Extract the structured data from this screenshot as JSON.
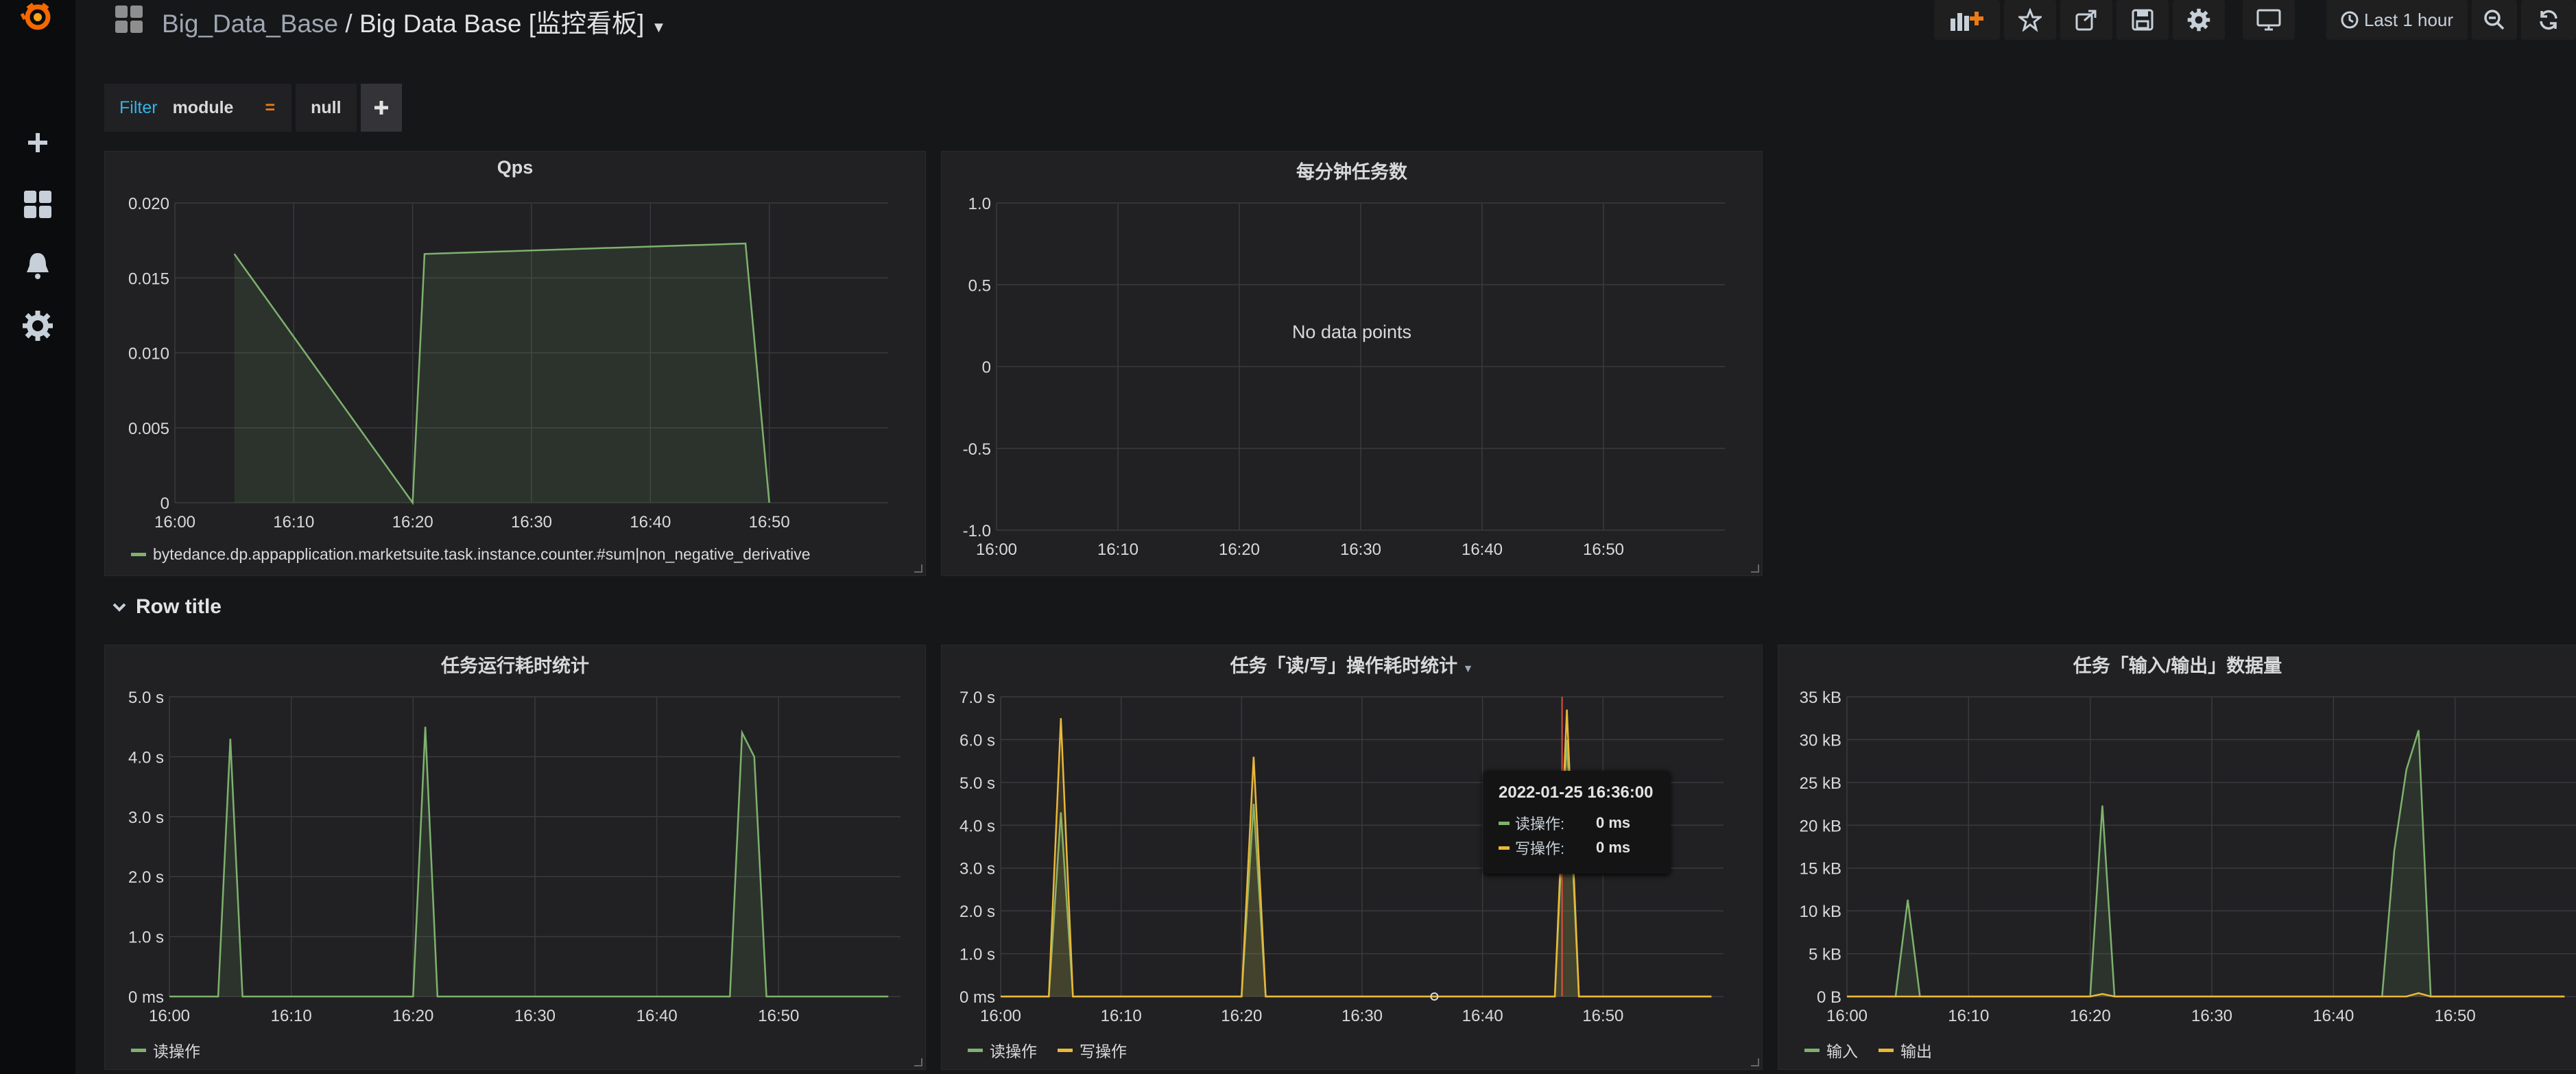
{
  "breadcrumb": {
    "folder": "Big_Data_Base",
    "separator": "/",
    "dashboard": "Big Data Base [监控看板]"
  },
  "time_picker": {
    "label": "Last 1 hour"
  },
  "filter": {
    "label": "Filter",
    "key": "module",
    "operator": "=",
    "value": "null"
  },
  "row": {
    "title": "Row title"
  },
  "colors": {
    "green": "#7eb26d",
    "yellow": "#eab839",
    "red": "#e24d42"
  },
  "panels": {
    "qps": {
      "title": "Qps",
      "legend": [
        "bytedance.dp.appapplication.marketsuite.task.instance.counter.#sum|non_negative_derivative"
      ],
      "chart_data": {
        "type": "area",
        "title": "Qps",
        "x_ticks": [
          "16:00",
          "16:10",
          "16:20",
          "16:30",
          "16:40",
          "16:50"
        ],
        "y_ticks": [
          "0",
          "0.005",
          "0.010",
          "0.015",
          "0.020"
        ],
        "ylim": [
          0,
          0.02
        ],
        "grid": true,
        "legend_position": "bottom",
        "series": [
          {
            "name": "bytedance.dp.appapplication.marketsuite.task.instance.counter.#sum|non_negative_derivative",
            "color": "green",
            "points": [
              [
                "16:05",
                0.0166
              ],
              [
                "16:20",
                0.0
              ],
              [
                "16:21",
                0.0166
              ],
              [
                "16:48",
                0.0173
              ],
              [
                "16:50",
                0.0
              ]
            ]
          }
        ]
      }
    },
    "tasks_per_min": {
      "title": "每分钟任务数",
      "message": "No data points",
      "chart_data": {
        "type": "line",
        "title": "每分钟任务数",
        "x_ticks": [
          "16:00",
          "16:10",
          "16:20",
          "16:30",
          "16:40",
          "16:50"
        ],
        "y_ticks": [
          "1.0",
          "0.5",
          "0",
          "-0.5",
          "-1.0"
        ],
        "ylim": [
          -1.0,
          1.0
        ],
        "grid": true,
        "series": []
      }
    },
    "runtime": {
      "title": "任务运行耗时统计",
      "legend": [
        "读操作"
      ],
      "chart_data": {
        "type": "area",
        "title": "任务运行耗时统计",
        "x_ticks": [
          "16:00",
          "16:10",
          "16:20",
          "16:30",
          "16:40",
          "16:50"
        ],
        "y_ticks": [
          "0 ms",
          "1.0 s",
          "2.0 s",
          "3.0 s",
          "4.0 s",
          "5.0 s"
        ],
        "ylim": [
          0,
          5.0
        ],
        "grid": true,
        "legend_position": "bottom",
        "series": [
          {
            "name": "读操作",
            "color": "green",
            "points": [
              [
                "16:00",
                0
              ],
              [
                "16:04",
                0
              ],
              [
                "16:05",
                4.3
              ],
              [
                "16:06",
                0
              ],
              [
                "16:20",
                0
              ],
              [
                "16:21",
                4.5
              ],
              [
                "16:22",
                0
              ],
              [
                "16:46",
                0
              ],
              [
                "16:47",
                4.4
              ],
              [
                "16:48",
                4.0
              ],
              [
                "16:49",
                0
              ],
              [
                "16:59",
                0
              ]
            ]
          }
        ]
      }
    },
    "rw_latency": {
      "title": "任务「读/写」操作耗时统计",
      "legend": [
        "读操作",
        "写操作"
      ],
      "tooltip": {
        "time": "2022-01-25 16:36:00",
        "rows": [
          {
            "label": "读操作:",
            "value": "0 ms"
          },
          {
            "label": "写操作:",
            "value": "0 ms"
          }
        ]
      },
      "chart_data": {
        "type": "line",
        "title": "任务「读/写」操作耗时统计",
        "x_ticks": [
          "16:00",
          "16:10",
          "16:20",
          "16:30",
          "16:40",
          "16:50"
        ],
        "y_ticks": [
          "0 ms",
          "1.0 s",
          "2.0 s",
          "3.0 s",
          "4.0 s",
          "5.0 s",
          "6.0 s",
          "7.0 s"
        ],
        "ylim": [
          0,
          7.0
        ],
        "grid": true,
        "legend_position": "bottom",
        "series": [
          {
            "name": "读操作",
            "color": "green",
            "points": [
              [
                "16:00",
                0
              ],
              [
                "16:04",
                0
              ],
              [
                "16:05",
                4.3
              ],
              [
                "16:06",
                0
              ],
              [
                "16:20",
                0
              ],
              [
                "16:21",
                4.5
              ],
              [
                "16:22",
                0
              ],
              [
                "16:46",
                0
              ],
              [
                "16:47",
                6.0
              ],
              [
                "16:48",
                0
              ],
              [
                "16:59",
                0
              ]
            ]
          },
          {
            "name": "写操作",
            "color": "yellow",
            "points": [
              [
                "16:00",
                0
              ],
              [
                "16:04",
                0
              ],
              [
                "16:05",
                6.5
              ],
              [
                "16:06",
                0
              ],
              [
                "16:20",
                0
              ],
              [
                "16:21",
                5.6
              ],
              [
                "16:22",
                0
              ],
              [
                "16:46",
                0
              ],
              [
                "16:47",
                6.7
              ],
              [
                "16:48",
                0
              ],
              [
                "16:59",
                0
              ]
            ]
          }
        ]
      }
    },
    "io_volume": {
      "title": "任务「输入/输出」数据量",
      "legend": [
        "输入",
        "输出"
      ],
      "chart_data": {
        "type": "area",
        "title": "任务「输入/输出」数据量",
        "x_ticks": [
          "16:00",
          "16:10",
          "16:20",
          "16:30",
          "16:40",
          "16:50"
        ],
        "y_ticks": [
          "0 B",
          "5 kB",
          "10 kB",
          "15 kB",
          "20 kB",
          "25 kB",
          "30 kB",
          "35 kB"
        ],
        "ylim": [
          0,
          35
        ],
        "grid": true,
        "legend_position": "bottom",
        "series": [
          {
            "name": "输入",
            "color": "green",
            "points": [
              [
                "16:00",
                0
              ],
              [
                "16:04",
                0
              ],
              [
                "16:05",
                11.3
              ],
              [
                "16:06",
                0
              ],
              [
                "16:20",
                0
              ],
              [
                "16:21",
                22.3
              ],
              [
                "16:22",
                0
              ],
              [
                "16:44",
                0
              ],
              [
                "16:45",
                17
              ],
              [
                "16:46",
                26.5
              ],
              [
                "16:47",
                31.1
              ],
              [
                "16:48",
                0
              ],
              [
                "16:59",
                0
              ]
            ]
          },
          {
            "name": "输出",
            "color": "yellow",
            "points": [
              [
                "16:00",
                0
              ],
              [
                "16:20",
                0
              ],
              [
                "16:21",
                0.3
              ],
              [
                "16:22",
                0
              ],
              [
                "16:46",
                0
              ],
              [
                "16:47",
                0.4
              ],
              [
                "16:48",
                0
              ],
              [
                "16:59",
                0
              ]
            ]
          }
        ]
      }
    }
  }
}
